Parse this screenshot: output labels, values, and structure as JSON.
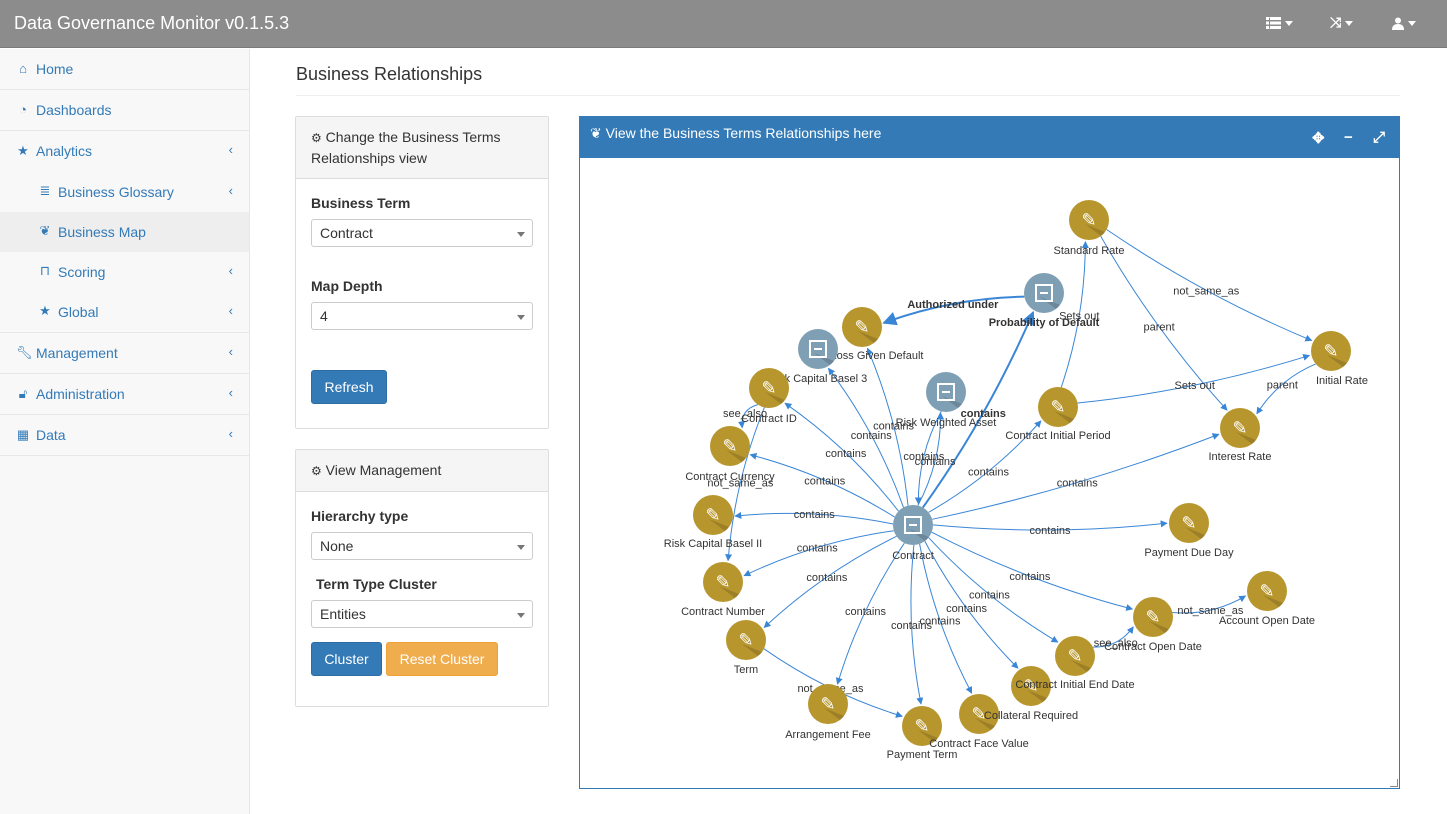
{
  "app": {
    "title": "Data Governance Monitor v0.1.5.3",
    "nav_icons": [
      "list-icon",
      "random-icon",
      "user-icon"
    ]
  },
  "sidebar": {
    "items": [
      {
        "label": "Home",
        "icon": "home-icon"
      },
      {
        "label": "Dashboards",
        "icon": "dashboard-icon"
      },
      {
        "label": "Analytics",
        "icon": "star-icon"
      },
      {
        "label": "Business Glossary",
        "icon": "database-icon"
      },
      {
        "label": "Business Map",
        "icon": "leaf-icon"
      },
      {
        "label": "Scoring",
        "icon": "bookmark-icon"
      },
      {
        "label": "Global",
        "icon": "star-icon"
      },
      {
        "label": "Management",
        "icon": "wrench-icon"
      },
      {
        "label": "Administration",
        "icon": "unlock-icon"
      },
      {
        "label": "Data",
        "icon": "table-icon"
      }
    ]
  },
  "page": {
    "title": "Business Relationships"
  },
  "view_panel": {
    "heading": "Change the Business Terms Relationships view",
    "business_term_label": "Business Term",
    "business_term_value": "Contract",
    "map_depth_label": "Map Depth",
    "map_depth_value": "4",
    "refresh_label": "Refresh"
  },
  "management_panel": {
    "heading": "View Management",
    "hierarchy_label": "Hierarchy type",
    "hierarchy_value": "None",
    "cluster_label": "Term Type Cluster",
    "cluster_value": "Entities",
    "cluster_button": "Cluster",
    "reset_button": "Reset Cluster"
  },
  "graph": {
    "title": "View the Business Terms Relationships here",
    "colors": {
      "term": "#b8962e",
      "group": "#7f9fb4",
      "edge": "#3a86d6"
    },
    "nodes": [
      {
        "id": "contract",
        "label": "Contract",
        "kind": "group"
      },
      {
        "id": "standard_rate",
        "label": "Standard Rate",
        "kind": "term"
      },
      {
        "id": "prob_default",
        "label": "Probability of Default",
        "kind": "group"
      },
      {
        "id": "loss_given_default",
        "label": "Loss Given Default",
        "kind": "term"
      },
      {
        "id": "risk_capital_b3",
        "label": "Risk Capital Basel 3",
        "kind": "group"
      },
      {
        "id": "contract_id",
        "label": "Contract ID",
        "kind": "term"
      },
      {
        "id": "rwa",
        "label": "Risk Weighted Asset",
        "kind": "group"
      },
      {
        "id": "contract_currency",
        "label": "Contract Currency",
        "kind": "term"
      },
      {
        "id": "risk_capital_b2",
        "label": "Risk Capital Basel II",
        "kind": "term"
      },
      {
        "id": "contract_number",
        "label": "Contract Number",
        "kind": "term"
      },
      {
        "id": "term",
        "label": "Term",
        "kind": "term"
      },
      {
        "id": "arrangement_fee",
        "label": "Arrangement Fee",
        "kind": "term"
      },
      {
        "id": "payment_term",
        "label": "Payment Term",
        "kind": "term"
      },
      {
        "id": "contract_face_value",
        "label": "Contract Face Value",
        "kind": "term"
      },
      {
        "id": "collateral_required",
        "label": "Collateral Required",
        "kind": "term"
      },
      {
        "id": "contract_end_date",
        "label": "Contract Initial End Date",
        "kind": "term"
      },
      {
        "id": "contract_open_date",
        "label": "Contract Open Date",
        "kind": "term"
      },
      {
        "id": "account_open_date",
        "label": "Account Open Date",
        "kind": "term"
      },
      {
        "id": "payment_due_day",
        "label": "Payment Due Day",
        "kind": "term"
      },
      {
        "id": "interest_rate",
        "label": "Interest Rate",
        "kind": "term"
      },
      {
        "id": "initial_rate",
        "label": "Initial Rate",
        "kind": "term"
      },
      {
        "id": "contract_initial_period",
        "label": "Contract Initial Period",
        "kind": "term"
      }
    ],
    "edges": [
      {
        "from": "contract",
        "to": "prob_default",
        "label": "contains",
        "bold": true
      },
      {
        "from": "contract",
        "to": "loss_given_default",
        "label": "contains"
      },
      {
        "from": "contract",
        "to": "risk_capital_b3",
        "label": "contains"
      },
      {
        "from": "contract",
        "to": "contract_id",
        "label": "contains"
      },
      {
        "from": "contract",
        "to": "rwa",
        "label": "contains"
      },
      {
        "from": "contract",
        "to": "contract_currency",
        "label": "contains"
      },
      {
        "from": "contract",
        "to": "risk_capital_b2",
        "label": "contains"
      },
      {
        "from": "contract",
        "to": "contract_number",
        "label": "contains"
      },
      {
        "from": "contract",
        "to": "term",
        "label": "contains"
      },
      {
        "from": "contract",
        "to": "arrangement_fee",
        "label": "contains"
      },
      {
        "from": "contract",
        "to": "payment_term",
        "label": "contains"
      },
      {
        "from": "contract",
        "to": "contract_face_value",
        "label": "contains"
      },
      {
        "from": "contract",
        "to": "collateral_required",
        "label": "contains"
      },
      {
        "from": "contract",
        "to": "contract_end_date",
        "label": "contains"
      },
      {
        "from": "contract",
        "to": "contract_open_date",
        "label": "contains"
      },
      {
        "from": "contract",
        "to": "payment_due_day",
        "label": "contains"
      },
      {
        "from": "contract",
        "to": "interest_rate",
        "label": "contains"
      },
      {
        "from": "contract",
        "to": "contract_initial_period",
        "label": "contains"
      },
      {
        "from": "prob_default",
        "to": "loss_given_default",
        "label": "Authorized under",
        "bold": true
      },
      {
        "from": "contract_initial_period",
        "to": "standard_rate",
        "label": "Sets out"
      },
      {
        "from": "contract_initial_period",
        "to": "initial_rate",
        "label": "Sets out"
      },
      {
        "from": "standard_rate",
        "to": "initial_rate",
        "label": "not_same_as"
      },
      {
        "from": "standard_rate",
        "to": "interest_rate",
        "label": "parent"
      },
      {
        "from": "initial_rate",
        "to": "interest_rate",
        "label": "parent"
      },
      {
        "from": "contract_open_date",
        "to": "account_open_date",
        "label": "not_same_as"
      },
      {
        "from": "contract_end_date",
        "to": "contract_open_date",
        "label": "see_also"
      },
      {
        "from": "contract_id",
        "to": "contract_currency",
        "label": "see_also"
      },
      {
        "from": "contract_id",
        "to": "contract_number",
        "label": "not_same_as"
      },
      {
        "from": "term",
        "to": "payment_term",
        "label": "not_same_as"
      },
      {
        "from": "rwa",
        "to": "contract",
        "label": "contains"
      }
    ]
  }
}
